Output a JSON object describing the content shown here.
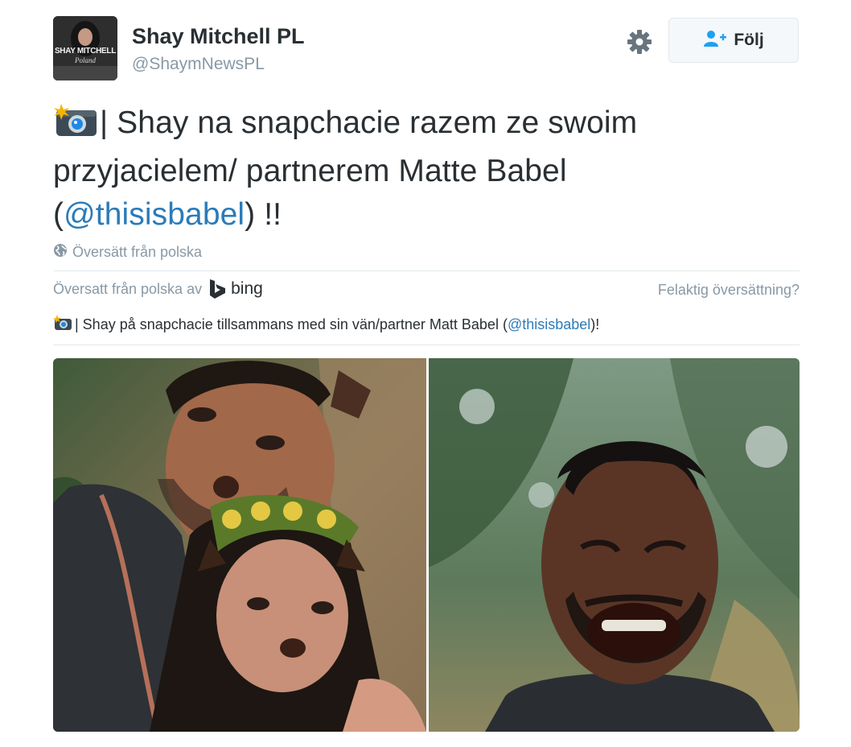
{
  "account": {
    "display_name": "Shay Mitchell PL",
    "handle": "@ShaymNewsPL",
    "avatar_text": "SHAY MITCHELL",
    "avatar_subtext": "Poland"
  },
  "actions": {
    "follow_label": "Följ",
    "settings_icon": "gear-icon",
    "follow_icon": "add-user-icon"
  },
  "tweet": {
    "text_before": "| Shay na snapchacie razem ze swoim przyjacielem/ partnerem Matte Babel (",
    "mention": "@thisisbabel",
    "text_after": ") !!",
    "emoji": "camera-with-flash-icon"
  },
  "translation": {
    "link_label": "Översätt från polska",
    "translated_by": "Översatt från polska av",
    "provider": "bing",
    "wrong_translation": "Felaktig översättning?",
    "text_before": "| Shay på snapchacie tillsammans med sin vän/partner Matt Babel (",
    "mention": "@thisisbabel",
    "text_after": ")!"
  },
  "colors": {
    "link": "#2b7bb9",
    "muted": "#8899a6",
    "text": "#292f33",
    "border": "#e1e8ed"
  }
}
